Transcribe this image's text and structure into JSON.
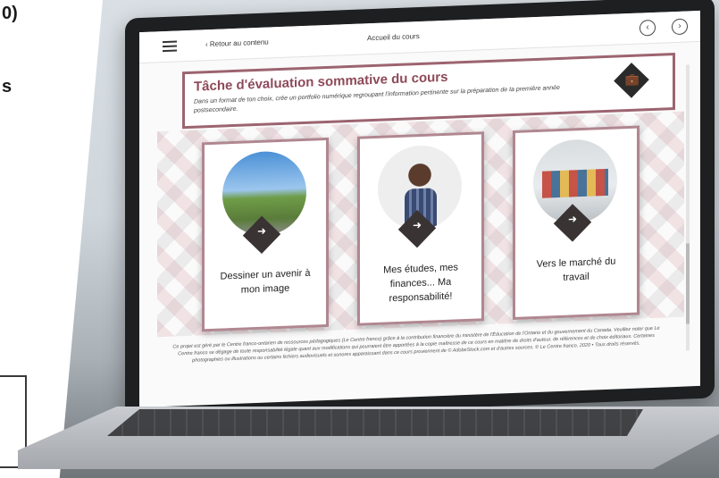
{
  "background_fragments": {
    "top_text": "0)",
    "middle_text": "s"
  },
  "topbar": {
    "back_label": "Retour au contenu",
    "course_home_label": "Accueil du cours",
    "prev_icon": "chevron-left-circle-icon",
    "next_icon": "chevron-right-circle-icon"
  },
  "task": {
    "title": "Tâche d'évaluation sommative du cours",
    "description": "Dans un format de ton choix, crée un portfolio numérique regroupant l'information pertinente sur la préparation de ta première année postsecondaire.",
    "icon": "briefcase-icon"
  },
  "cards": [
    {
      "label": "Dessiner un avenir à mon image",
      "image": "road-landscape"
    },
    {
      "label": "Mes études, mes finances... Ma responsabilité!",
      "image": "student-portrait"
    },
    {
      "label": "Vers le marché du travail",
      "image": "people-sitting"
    }
  ],
  "footer": {
    "text": "Ce projet est géré par le Centre franco-ontarien de ressources pédagogiques (Le Centre franco) grâce à la contribution financière du ministère de l'Éducation de l'Ontario et du gouvernement du Canada. Veuillez noter que Le Centre franco se dégage de toute responsabilité légale quant aux modifications qui pourraient être apportées à la copie maîtresse de ce cours en matière de droits d'auteur, de références et de choix éditoriaux. Certaines photographies ou illustrations ou certains fichiers audiovisuels et sonores apparaissant dans ce cours proviennent de © AdobeStock.com et d'autres sources. © Le Centre franco, 2020 • Tous droits réservés."
  }
}
